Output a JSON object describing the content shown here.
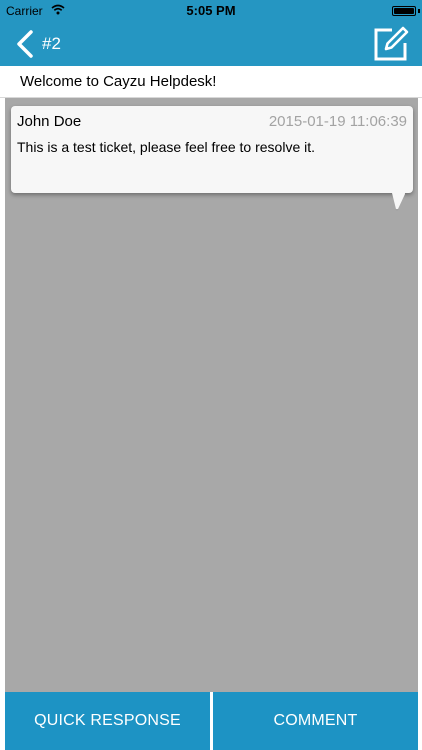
{
  "status_bar": {
    "carrier": "Carrier",
    "time": "5:05 PM",
    "battery_level": 1.0
  },
  "nav": {
    "back_icon": "chevron-left-icon",
    "title": "#2",
    "compose_icon": "compose-edit-icon"
  },
  "ticket": {
    "subject": "Welcome to Cayzu Helpdesk!"
  },
  "messages": [
    {
      "author": "John Doe",
      "timestamp": "2015-01-19 11:06:39",
      "body": "This is a test ticket, please feel free to resolve it."
    }
  ],
  "actions": {
    "quick_response": "QUICK RESPONSE",
    "comment": "COMMENT"
  },
  "colors": {
    "brand": "#2596c2",
    "button": "#1d93c4",
    "thread_background": "#a8a8a8",
    "timestamp_text": "#a3a3a3"
  }
}
